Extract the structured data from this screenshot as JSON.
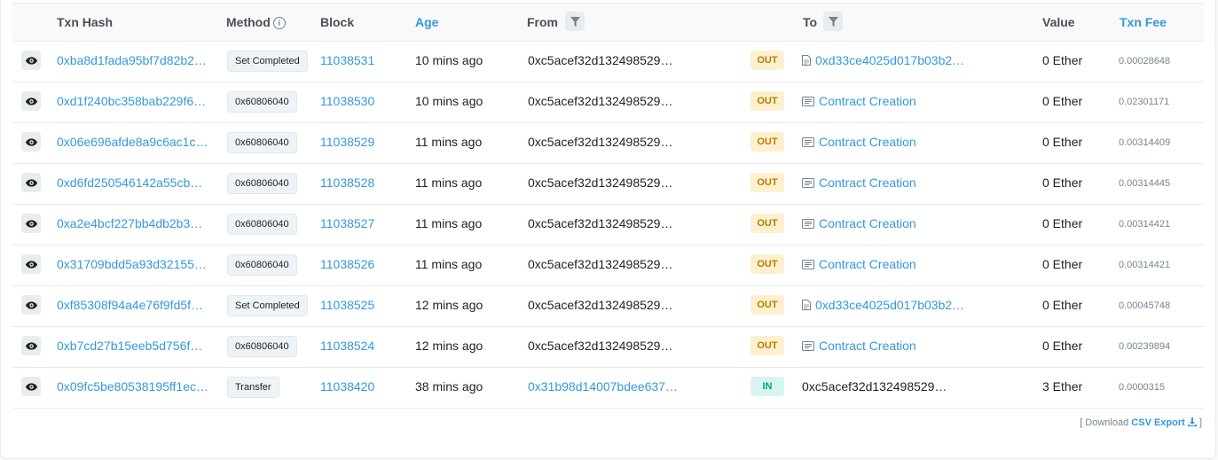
{
  "headers": {
    "txn_hash": "Txn Hash",
    "method": "Method",
    "block": "Block",
    "age": "Age",
    "from": "From",
    "to": "To",
    "value": "Value",
    "txn_fee": "Txn Fee"
  },
  "rows": [
    {
      "hash": "0xba8d1fada95bf7d82b2…",
      "method": "Set Completed",
      "block": "11038531",
      "age": "10 mins ago",
      "from": "0xc5acef32d132498529…",
      "dir": "OUT",
      "to": "0xd33ce4025d017b03b2…",
      "to_type": "contract",
      "value": "0 Ether",
      "fee": "0.00028648"
    },
    {
      "hash": "0xd1f240bc358bab229f6…",
      "method": "0x60806040",
      "block": "11038530",
      "age": "10 mins ago",
      "from": "0xc5acef32d132498529…",
      "dir": "OUT",
      "to": "Contract Creation",
      "to_type": "creation",
      "value": "0 Ether",
      "fee": "0.02301171"
    },
    {
      "hash": "0x06e696afde8a9c6ac1c…",
      "method": "0x60806040",
      "block": "11038529",
      "age": "11 mins ago",
      "from": "0xc5acef32d132498529…",
      "dir": "OUT",
      "to": "Contract Creation",
      "to_type": "creation",
      "value": "0 Ether",
      "fee": "0.00314409"
    },
    {
      "hash": "0xd6fd250546142a55cb…",
      "method": "0x60806040",
      "block": "11038528",
      "age": "11 mins ago",
      "from": "0xc5acef32d132498529…",
      "dir": "OUT",
      "to": "Contract Creation",
      "to_type": "creation",
      "value": "0 Ether",
      "fee": "0.00314445"
    },
    {
      "hash": "0xa2e4bcf227bb4db2b3…",
      "method": "0x60806040",
      "block": "11038527",
      "age": "11 mins ago",
      "from": "0xc5acef32d132498529…",
      "dir": "OUT",
      "to": "Contract Creation",
      "to_type": "creation",
      "value": "0 Ether",
      "fee": "0.00314421"
    },
    {
      "hash": "0x31709bdd5a93d32155…",
      "method": "0x60806040",
      "block": "11038526",
      "age": "11 mins ago",
      "from": "0xc5acef32d132498529…",
      "dir": "OUT",
      "to": "Contract Creation",
      "to_type": "creation",
      "value": "0 Ether",
      "fee": "0.00314421"
    },
    {
      "hash": "0xf85308f94a4e76f9fd5f…",
      "method": "Set Completed",
      "block": "11038525",
      "age": "12 mins ago",
      "from": "0xc5acef32d132498529…",
      "dir": "OUT",
      "to": "0xd33ce4025d017b03b2…",
      "to_type": "contract",
      "value": "0 Ether",
      "fee": "0.00045748"
    },
    {
      "hash": "0xb7cd27b15eeb5d756f…",
      "method": "0x60806040",
      "block": "11038524",
      "age": "12 mins ago",
      "from": "0xc5acef32d132498529…",
      "dir": "OUT",
      "to": "Contract Creation",
      "to_type": "creation",
      "value": "0 Ether",
      "fee": "0.00239894"
    },
    {
      "hash": "0x09fc5be80538195ff1ec…",
      "method": "Transfer",
      "block": "11038420",
      "age": "38 mins ago",
      "from": "0x31b98d14007bdee637…",
      "dir": "IN",
      "to": "0xc5acef32d132498529…",
      "to_type": "plain",
      "value": "3 Ether",
      "fee": "0.0000315"
    }
  ],
  "footer": {
    "open": "[ Download",
    "csv_label": "CSV Export",
    "close": "]"
  },
  "colors": {
    "link": "#3498db",
    "out_bg": "#fdf0cf",
    "out_fg": "#b47d00",
    "in_bg": "#d7f5ef",
    "in_fg": "#00a186"
  }
}
